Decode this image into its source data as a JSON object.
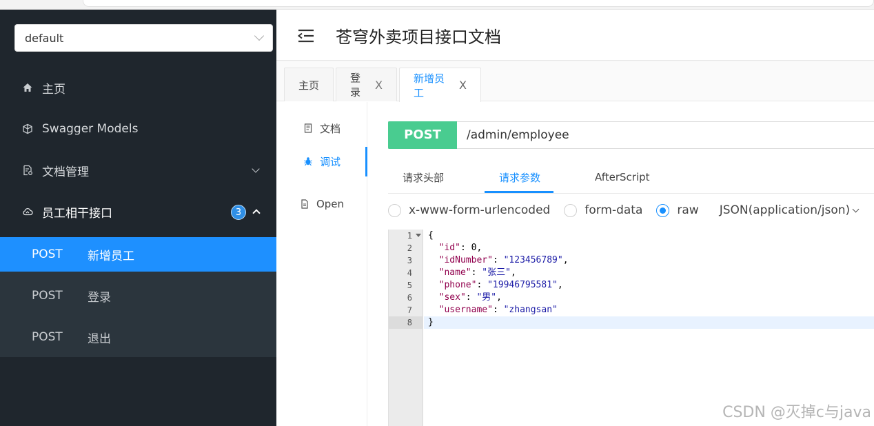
{
  "sidebar": {
    "group_select": "default",
    "menu": [
      {
        "label": "主页",
        "icon": "home-icon"
      },
      {
        "label": "Swagger Models",
        "icon": "cube-icon"
      },
      {
        "label": "文档管理",
        "icon": "doc-settings-icon"
      },
      {
        "label": "员工相干接口",
        "icon": "cloud-icon",
        "badge": "3"
      }
    ],
    "endpoints": [
      {
        "method": "POST",
        "label": "新增员工"
      },
      {
        "method": "POST",
        "label": "登录"
      },
      {
        "method": "POST",
        "label": "退出"
      }
    ]
  },
  "header": {
    "title": "苍穹外卖项目接口文档"
  },
  "tabs": [
    {
      "label": "主页"
    },
    {
      "label": "登录",
      "close": "X"
    },
    {
      "label": "新增员工",
      "close": "X"
    }
  ],
  "side_tabs": [
    {
      "label": "文档"
    },
    {
      "label": "调试"
    },
    {
      "label": "Open"
    }
  ],
  "request": {
    "method": "POST",
    "url": "/admin/employee",
    "tabs": [
      "请求头部",
      "请求参数",
      "AfterScript"
    ],
    "body_types": [
      "x-www-form-urlencoded",
      "form-data",
      "raw"
    ],
    "selected_body_type": "raw",
    "content_type": "JSON(application/json)"
  },
  "editor": {
    "line_numbers": [
      "1",
      "2",
      "3",
      "4",
      "5",
      "6",
      "7",
      "8"
    ],
    "body": {
      "open": "{",
      "close": "}",
      "fields": [
        {
          "key": "\"id\"",
          "value": "0",
          "type": "number"
        },
        {
          "key": "\"idNumber\"",
          "value": "\"123456789\"",
          "type": "string"
        },
        {
          "key": "\"name\"",
          "value": "\"张三\"",
          "type": "string"
        },
        {
          "key": "\"phone\"",
          "value": "\"19946795581\"",
          "type": "string"
        },
        {
          "key": "\"sex\"",
          "value": "\"男\"",
          "type": "string"
        },
        {
          "key": "\"username\"",
          "value": "\"zhangsan\"",
          "type": "string"
        }
      ]
    }
  },
  "watermark": "CSDN @灭掉c与java",
  "colors": {
    "sidebar_bg": "#1f262d",
    "active_blue": "#1890ff",
    "post_green": "#49cc90",
    "submenu_active": "#1e90ff"
  }
}
